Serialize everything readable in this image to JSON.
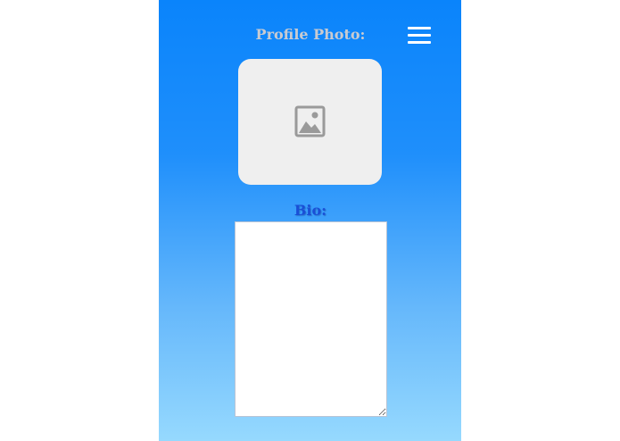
{
  "header": {
    "title": "Profile Photo:",
    "menu_icon": "hamburger-menu-icon"
  },
  "photo": {
    "placeholder_icon": "image-placeholder-icon"
  },
  "bio": {
    "label": "Bio:",
    "value": ""
  },
  "colors": {
    "gradient_top": "#0a84fb",
    "gradient_bottom": "#96d9fe",
    "heading_text": "#c9cbd1",
    "bio_label_text": "#1a4fd6",
    "photo_box": "#efefef"
  }
}
